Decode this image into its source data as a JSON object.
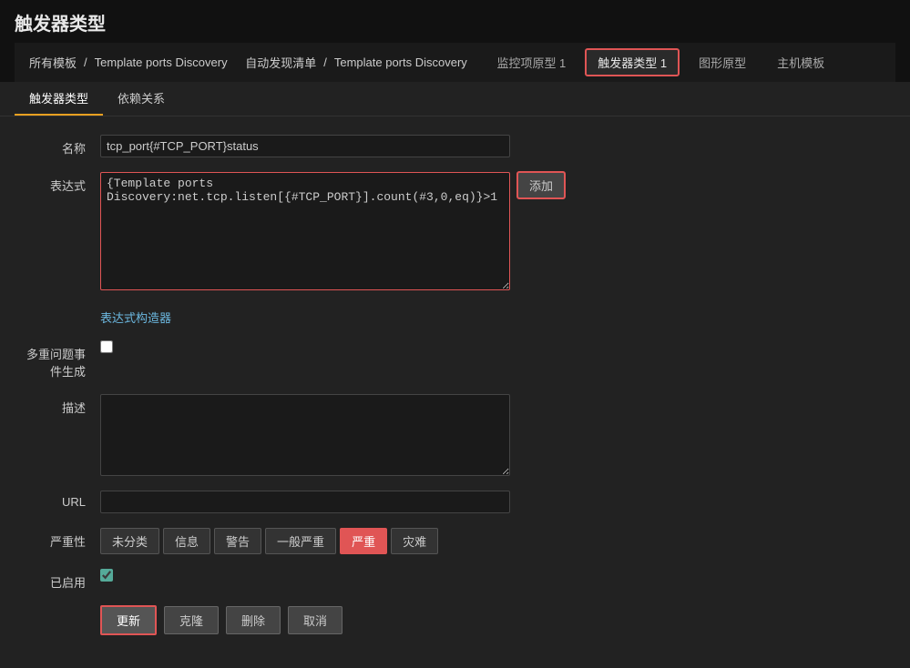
{
  "page": {
    "title": "触发器类型",
    "breadcrumb": {
      "all_templates": "所有模板",
      "sep1": "/",
      "tpd1": "Template ports Discovery",
      "auto_disc": "自动发现清单",
      "sep2": "/",
      "tpd2": "Template ports Discovery",
      "monitor_item": "监控项原型 1",
      "trigger_type": "触发器类型 1",
      "graph_proto": "图形原型",
      "host_tmpl": "主机模板"
    },
    "sub_tabs": [
      {
        "label": "触发器类型",
        "active": true
      },
      {
        "label": "依赖关系",
        "active": false
      }
    ],
    "form": {
      "name_label": "名称",
      "name_value": "tcp_port{#TCP_PORT}status",
      "expr_label": "表达式",
      "expr_value": "{Template ports Discovery:net.tcp.listen[{#TCP_PORT}].count(#3,0,eq)}>1",
      "expr_builder_label": "表达式构造器",
      "add_button": "添加",
      "multi_gen_label": "多重问题事件生成",
      "desc_label": "描述",
      "desc_value": "",
      "url_label": "URL",
      "url_value": "",
      "severity_label": "严重性",
      "severity_options": [
        {
          "label": "未分类",
          "active": false
        },
        {
          "label": "信息",
          "active": false
        },
        {
          "label": "警告",
          "active": false
        },
        {
          "label": "一般严重",
          "active": false
        },
        {
          "label": "严重",
          "active": true
        },
        {
          "label": "灾难",
          "active": false
        }
      ],
      "enabled_label": "已启用",
      "enabled_checked": true,
      "update_btn": "更新",
      "clone_btn": "克隆",
      "delete_btn": "删除",
      "cancel_btn": "取消"
    }
  }
}
